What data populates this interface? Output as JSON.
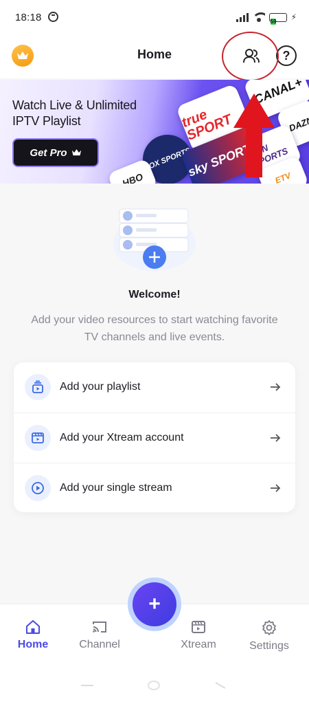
{
  "status_bar": {
    "time": "18:18",
    "battery_level": "59",
    "battery_fraction": 0.59,
    "icons": [
      "sync-icon",
      "signal-icon",
      "wifi-icon",
      "battery-icon",
      "charging-icon"
    ]
  },
  "header": {
    "title": "Home",
    "left_icon": "crown-icon",
    "right_icons": [
      "users-icon",
      "help-icon"
    ],
    "help_glyph": "?"
  },
  "banner": {
    "title": "Watch Live & Unlimited IPTV Playlist",
    "button_label": "Get Pro",
    "logos": [
      "true SPORT",
      "FOX SPORTS",
      "sky SPORTS",
      "beIN SPORTS",
      "CANAL+",
      "DAZN",
      "HBO",
      "ETV"
    ]
  },
  "welcome": {
    "title": "Welcome!",
    "text": "Add your video resources to start watching favorite TV channels and live events."
  },
  "actions": [
    {
      "label": "Add your playlist",
      "icon": "playlist-icon"
    },
    {
      "label": "Add your Xtream account",
      "icon": "clapperboard-icon"
    },
    {
      "label": "Add your single stream",
      "icon": "play-circle-icon"
    }
  ],
  "bottom_nav": {
    "items": [
      {
        "label": "Home",
        "icon": "home-icon",
        "active": true
      },
      {
        "label": "Channel",
        "icon": "cast-icon",
        "active": false
      },
      {
        "label": "Xtream",
        "icon": "clapperboard-icon",
        "active": false
      },
      {
        "label": "Settings",
        "icon": "gear-icon",
        "active": false
      }
    ],
    "fab_glyph": "+"
  },
  "colors": {
    "accent": "#4a4ae6",
    "crown": "#f5a623",
    "annotation": "#e0151e",
    "banner_purple": "#5a3fe3"
  }
}
